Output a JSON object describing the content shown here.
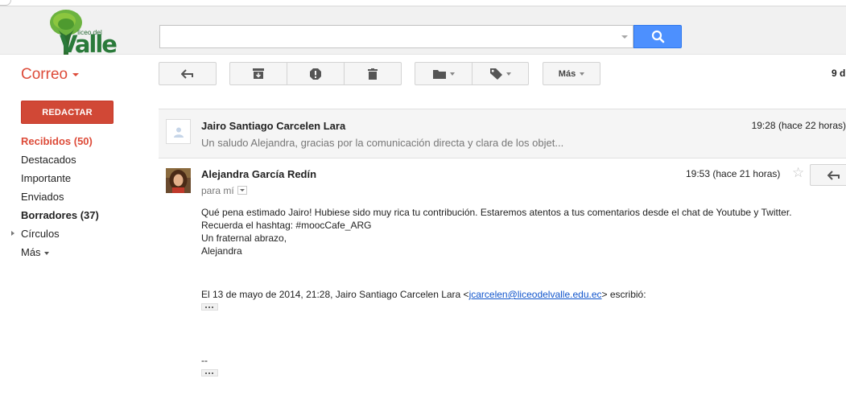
{
  "app": {
    "logo_small": "liceo del",
    "logo_big": "Valle"
  },
  "search": {
    "value": "",
    "placeholder": ""
  },
  "mail_label": "Correo",
  "toolbar": {
    "more_label": "Más",
    "count_text": "9 d"
  },
  "compose_label": "REDACTAR",
  "sidebar": {
    "items": [
      {
        "label": "Recibidos (50)"
      },
      {
        "label": "Destacados"
      },
      {
        "label": "Importante"
      },
      {
        "label": "Enviados"
      },
      {
        "label": "Borradores (37)"
      },
      {
        "label": "Círculos"
      },
      {
        "label": "Más"
      }
    ]
  },
  "thread": {
    "collapsed": {
      "sender": "Jairo Santiago Carcelen Lara",
      "snippet": "Un saludo Alejandra, gracias por la comunicación directa y clara de los objet...",
      "date": "19:28 (hace 22 horas)"
    },
    "open": {
      "sender": "Alejandra García Redín",
      "recipient": "para mí",
      "date": "19:53 (hace 21 horas)",
      "body_lines": [
        "Qué pena estimado Jairo! Hubiese sido muy rica tu contribución. Estaremos atentos a tus comentarios desde el chat de Youtube y Twitter.",
        "Recuerda el hashtag: #moocCafe_ARG",
        "Un fraternal abrazo,",
        "Alejandra"
      ],
      "quote_prefix": "El 13 de mayo de 2014, 21:28, Jairo Santiago Carcelen Lara <",
      "quote_email": "jcarcelen@liceodelvalle.edu.ec",
      "quote_suffix": "> escribió:",
      "signature_dash": "--"
    }
  },
  "colors": {
    "accent_red": "#dd4b39",
    "compose_red": "#d14836",
    "search_blue": "#4d90fe",
    "link_blue": "#1155cc"
  },
  "icons": [
    "search-icon",
    "reply-icon",
    "archive-icon",
    "report-spam-icon",
    "delete-icon",
    "folder-icon",
    "label-icon",
    "person-icon",
    "star-icon"
  ]
}
